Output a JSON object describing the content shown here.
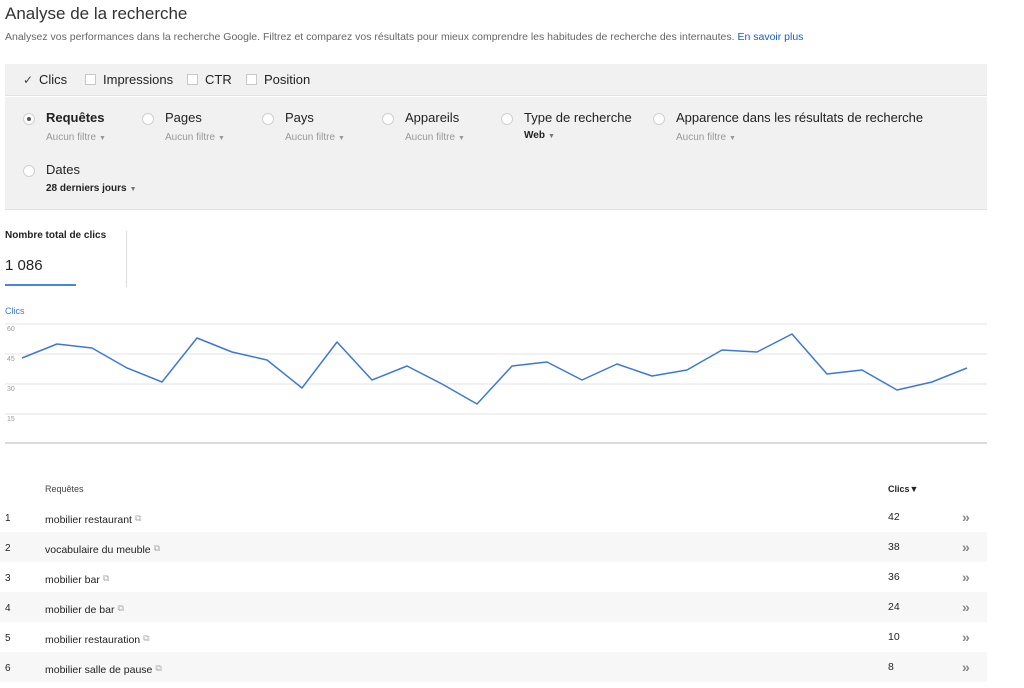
{
  "header": {
    "title": "Analyse de la recherche",
    "description": "Analysez vos performances dans la recherche Google. Filtrez et comparez vos résultats pour mieux comprendre les habitudes de recherche des internautes.",
    "learn_more": "En savoir plus"
  },
  "metrics": [
    {
      "label": "Clics",
      "checked": true
    },
    {
      "label": "Impressions",
      "checked": false
    },
    {
      "label": "CTR",
      "checked": false
    },
    {
      "label": "Position",
      "checked": false
    }
  ],
  "dimensions": [
    {
      "label": "Requêtes",
      "filter": "Aucun filtre",
      "selected": true
    },
    {
      "label": "Pages",
      "filter": "Aucun filtre",
      "selected": false
    },
    {
      "label": "Pays",
      "filter": "Aucun filtre",
      "selected": false
    },
    {
      "label": "Appareils",
      "filter": "Aucun filtre",
      "selected": false
    },
    {
      "label": "Type de recherche",
      "filter": "Web",
      "selected": false
    },
    {
      "label": "Apparence dans les résultats de recherche",
      "filter": "Aucun filtre",
      "selected": false
    },
    {
      "label": "Dates",
      "filter": "28 derniers jours",
      "selected": false
    }
  ],
  "summary": {
    "label": "Nombre total de clics",
    "value": "1 086"
  },
  "chart_data": {
    "type": "line",
    "series_label": "Clics",
    "y_ticks": [
      60,
      45,
      30,
      15
    ],
    "ylim": [
      0,
      60
    ],
    "grid": true,
    "color": "#3c78d8",
    "values": [
      43,
      50,
      48,
      38,
      31,
      53,
      46,
      42,
      28,
      51,
      32,
      39,
      30,
      20,
      39,
      41,
      32,
      40,
      34,
      37,
      47,
      46,
      55,
      35,
      37,
      27,
      31,
      38
    ]
  },
  "table": {
    "header_query": "Requêtes",
    "header_clicks": "Clics",
    "sort_icon": "▼",
    "rows": [
      {
        "num": "1",
        "query": "mobilier restaurant",
        "clicks": "42"
      },
      {
        "num": "2",
        "query": "vocabulaire du meuble",
        "clicks": "38"
      },
      {
        "num": "3",
        "query": "mobilier bar",
        "clicks": "36"
      },
      {
        "num": "4",
        "query": "mobilier de bar",
        "clicks": "24"
      },
      {
        "num": "5",
        "query": "mobilier restauration",
        "clicks": "10"
      },
      {
        "num": "6",
        "query": "mobilier salle de pause",
        "clicks": "8"
      }
    ]
  },
  "icons": {
    "check": "✓",
    "caret": "▼",
    "external": "⧉",
    "row_open": "»"
  }
}
